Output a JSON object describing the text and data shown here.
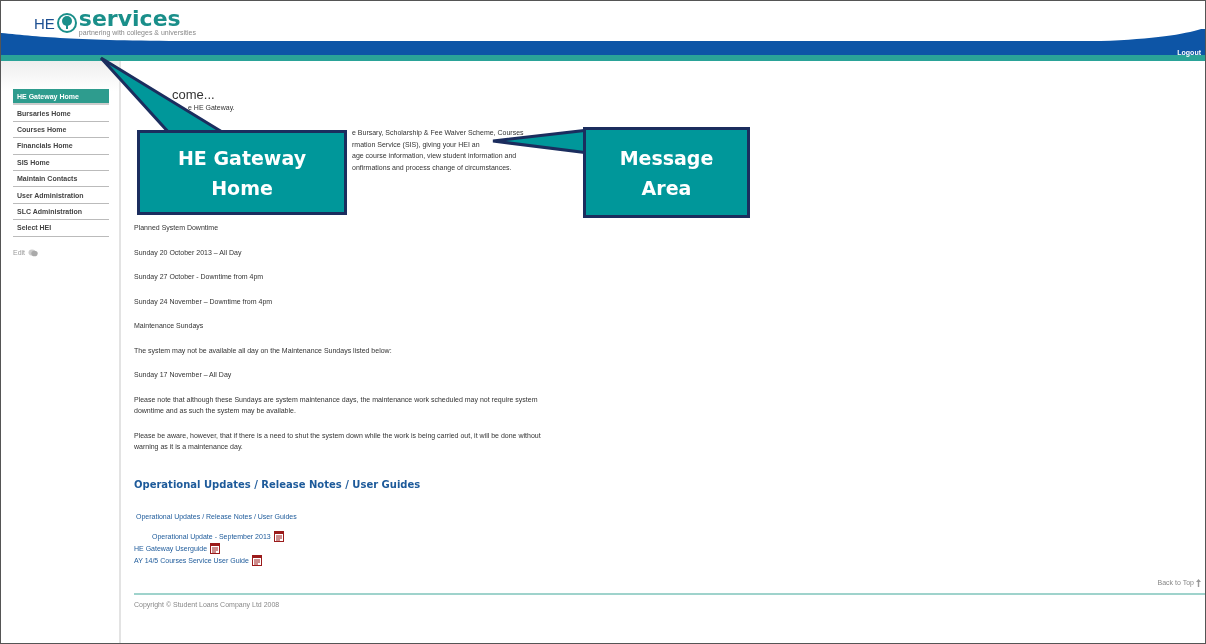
{
  "header": {
    "logo_prefix": "HE",
    "logo_name": "services",
    "tagline": "partnering with colleges & universities",
    "logout": "Logout"
  },
  "sidebar": {
    "items": [
      {
        "label": "HE Gateway Home",
        "selected": true
      },
      {
        "label": "Bursaries Home",
        "selected": false
      },
      {
        "label": "Courses Home",
        "selected": false
      },
      {
        "label": "Financials Home",
        "selected": false
      },
      {
        "label": "SIS Home",
        "selected": false
      },
      {
        "label": "Maintain Contacts",
        "selected": false
      },
      {
        "label": "User Administration",
        "selected": false
      },
      {
        "label": "SLC Administration",
        "selected": false
      },
      {
        "label": "Select HEI",
        "selected": false
      }
    ],
    "edit": "Edit"
  },
  "content": {
    "heading": "come...",
    "intro": "e HE Gateway.",
    "paragraph_lines": [
      "e Bursary, Scholarship & Fee Waiver Scheme, Courses",
      "rmation Service (SIS), giving your HEI an",
      "age course information, view student information and",
      "onfirmations and process change of circumstances."
    ],
    "notices": [
      "Planned System Downtime",
      "Sunday 20 October 2013 – All Day",
      "Sunday 27 October - Downtime from 4pm",
      "Sunday 24 November – Downtime from 4pm",
      "Maintenance Sundays",
      "The system may not be available all day on the Maintenance Sundays listed below:",
      "Sunday 17 November – All Day",
      "Please note that although these Sundays are system maintenance days, the maintenance work scheduled may not require system downtime and as such the system may be available.",
      "Please be aware, however, that if there is a need to shut the system down while the work is being carried out, it will be done without warning as it is a maintenance day."
    ],
    "updates_title": "Operational Updates / Release Notes / User Guides",
    "links": [
      {
        "label": "Operational Updates / Release Notes / User Guides",
        "kind": "folder"
      },
      {
        "label": "Operational Update - September 2013",
        "kind": "subdoc"
      },
      {
        "label": "HE Gateway Userguide",
        "kind": "doc"
      },
      {
        "label": "AY 14/5 Courses Service User Guide",
        "kind": "doc"
      }
    ],
    "back_to_top": "Back to Top",
    "copyright": "Copyright © Student Loans Company Ltd 2008"
  },
  "callouts": [
    {
      "text": "HE Gateway Home"
    },
    {
      "text": "Message Area"
    }
  ]
}
